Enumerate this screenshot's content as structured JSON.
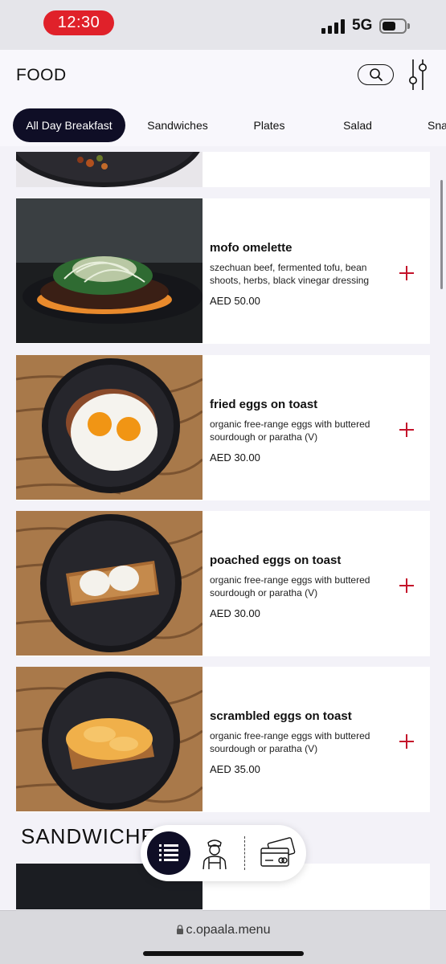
{
  "status_bar": {
    "time": "12:30",
    "network": "5G",
    "battery_level": 0.6
  },
  "header": {
    "title": "FOOD"
  },
  "tabs": [
    {
      "label": "All Day Breakfast",
      "active": true
    },
    {
      "label": "Sandwiches",
      "active": false
    },
    {
      "label": "Plates",
      "active": false
    },
    {
      "label": "Salad",
      "active": false
    },
    {
      "label": "Sna",
      "active": false
    }
  ],
  "items": [
    {
      "name": "mofo omelette",
      "description": "szechuan beef, fermented tofu, bean shoots, herbs, black vinegar dressing",
      "price": "AED 50.00"
    },
    {
      "name": "fried eggs on toast",
      "description": "organic free-range eggs with buttered sourdough or paratha (V)",
      "price": "AED 30.00"
    },
    {
      "name": "poached eggs on toast",
      "description": "organic free-range eggs with buttered sourdough or paratha (V)",
      "price": "AED 30.00"
    },
    {
      "name": "scrambled eggs on toast",
      "description": "organic free-range eggs with buttered sourdough or paratha (V)",
      "price": "AED 35.00"
    }
  ],
  "section": {
    "heading": "SANDWICHES"
  },
  "browser": {
    "url": "c.opaala.menu"
  },
  "colors": {
    "accent": "#c4122a",
    "dark": "#0f0e26",
    "time_pill": "#e0212a"
  }
}
